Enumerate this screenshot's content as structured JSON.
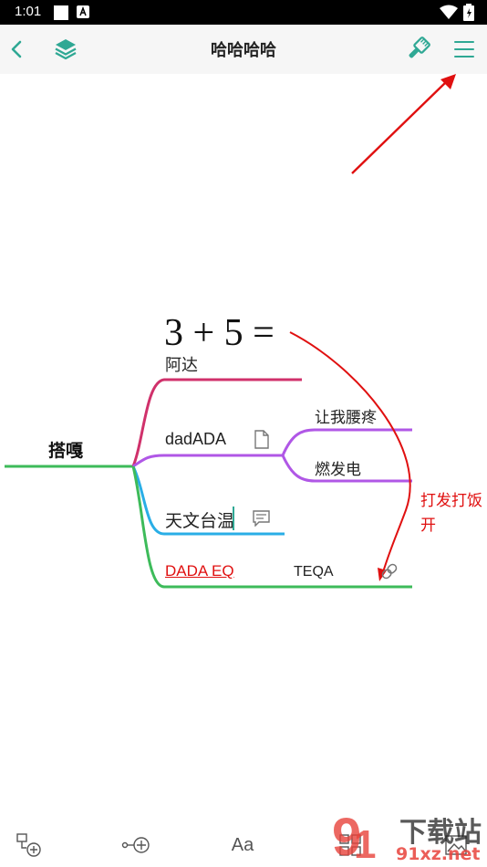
{
  "status_bar": {
    "time": "1:01"
  },
  "toolbar": {
    "title": "哈哈哈哈"
  },
  "mindmap": {
    "root": "搭嘎",
    "formula": "3 + 5 =",
    "branch1": "阿达",
    "branch2": "dadADA",
    "branch2_child1": "让我腰疼",
    "branch2_child2": "燃发电",
    "branch3": "天文台温",
    "branch4_link": "DADA EQ",
    "branch4_text": "TEQA",
    "annotation_line1": "打发打饭",
    "annotation_line2": "开"
  },
  "bottom_bar": {
    "font_label": "Aa"
  },
  "watermark": {
    "brand": "下载站",
    "site": "91xz.net"
  },
  "colors": {
    "accent": "#2fa894",
    "branch1": "#d0316b",
    "branch2": "#b057e6",
    "branch3": "#29aee6",
    "branch4": "#3dbb5a",
    "annotation": "#e01010"
  }
}
